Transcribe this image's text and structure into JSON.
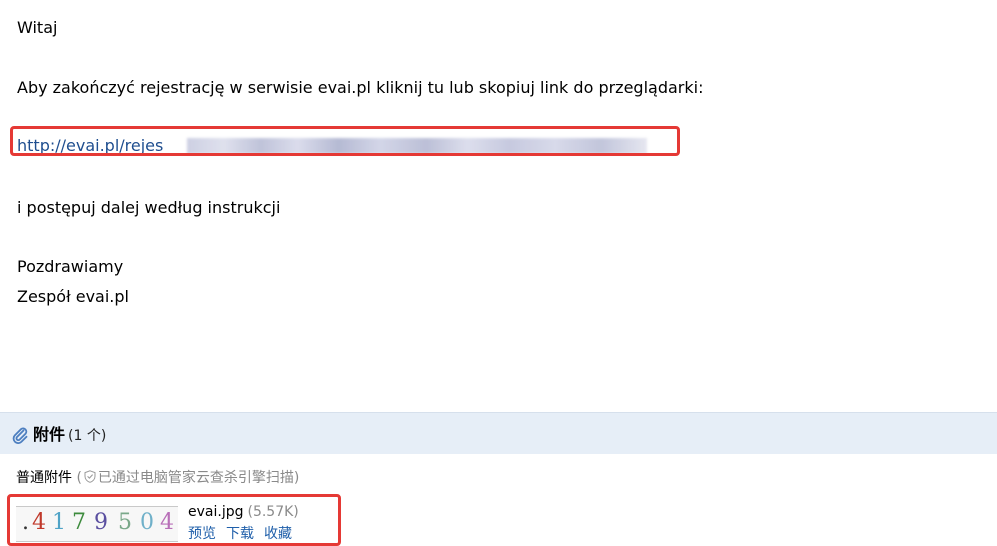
{
  "email": {
    "greeting": "Witaj",
    "instruction": "Aby zakończyć rejestrację w serwisie evai.pl kliknij tu lub skopiuj link do przeglądarki:",
    "link_visible": "http://evai.pl/rejes",
    "follow_up": "i postępuj dalej według instrukcji",
    "closing": "Pozdrawiamy",
    "signature": "Zespół evai.pl"
  },
  "attachments": {
    "title": "附件",
    "count": "(1 个)",
    "group_label": "普通附件",
    "scan_prefix": "(",
    "scan_text": "已通过电脑管家云查杀引擎扫描)",
    "files": [
      {
        "name": "evai.jpg",
        "size": "(5.57K)",
        "actions": [
          "预览",
          "下载",
          "收藏"
        ],
        "thumbnail_digits": [
          ".",
          "4",
          "1",
          "7",
          "9",
          "5",
          "0",
          "4"
        ]
      }
    ]
  },
  "colors": {
    "highlight_border": "#e53935",
    "link": "#1f4e8f",
    "attach_header_bg": "#e6eef7",
    "action_link": "#1f5faa"
  }
}
